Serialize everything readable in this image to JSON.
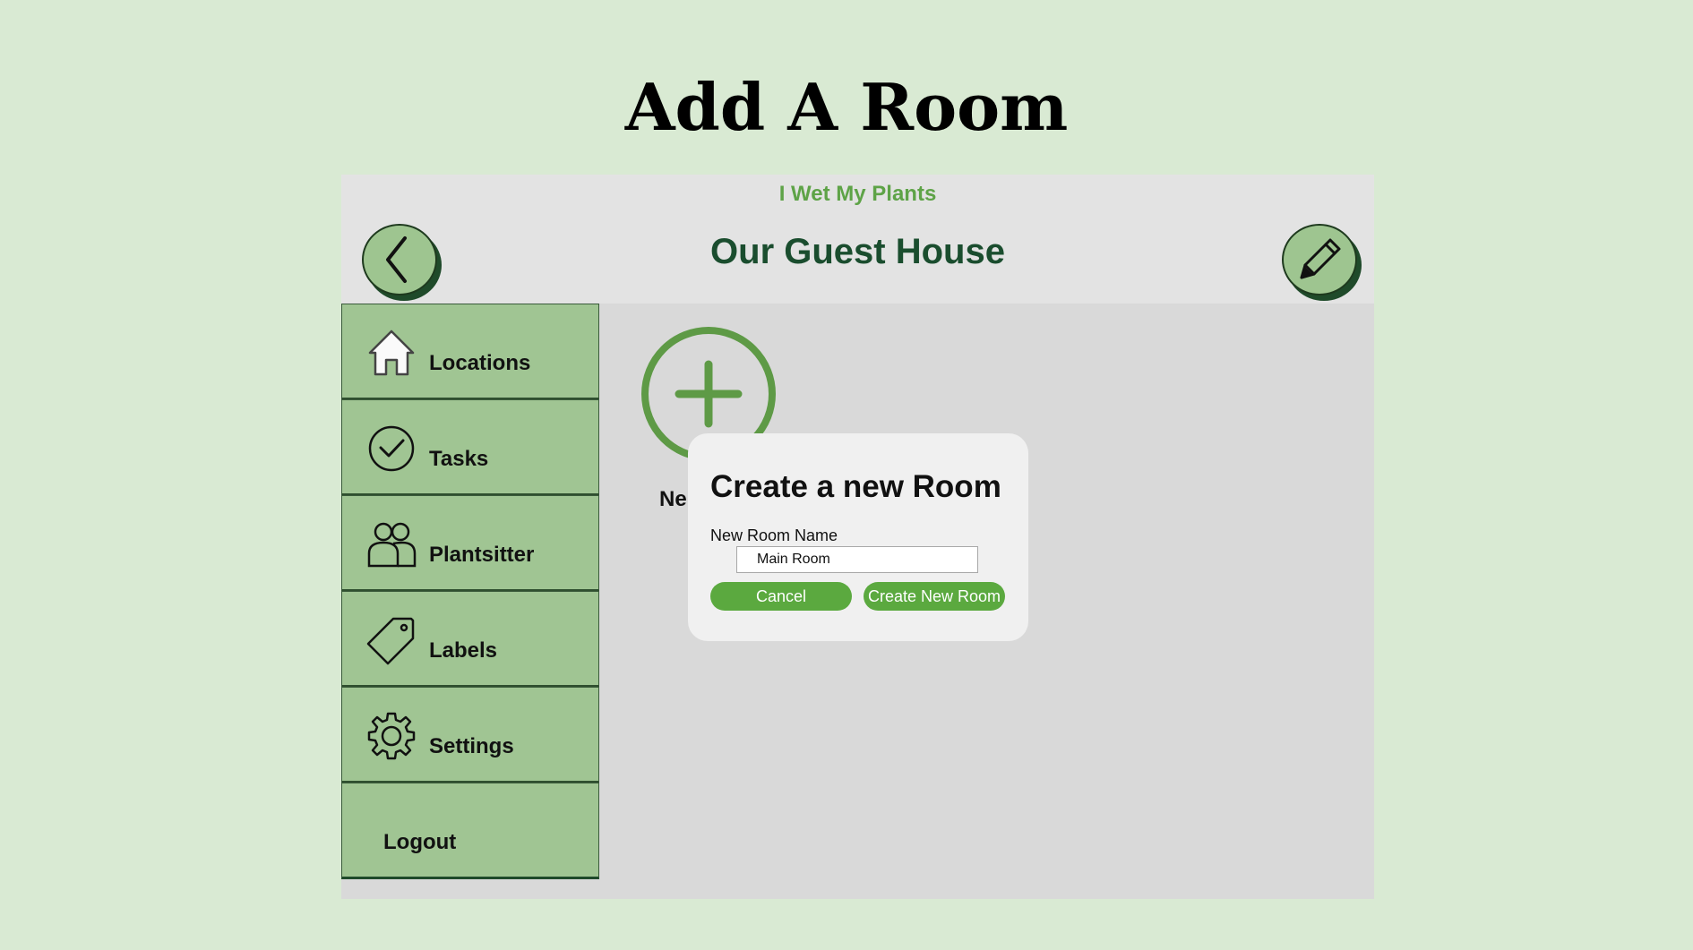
{
  "slide": {
    "title": "Add A Room",
    "background": "#d9ead3"
  },
  "app": {
    "brand": "I Wet My Plants",
    "heading": "Our Guest House",
    "back_icon": "chevron-left-icon",
    "edit_icon": "pencil-icon"
  },
  "sidebar": {
    "items": [
      {
        "label": "Locations",
        "icon": "home-icon"
      },
      {
        "label": "Tasks",
        "icon": "check-circle-icon"
      },
      {
        "label": "Plantsitter",
        "icon": "users-icon"
      },
      {
        "label": "Labels",
        "icon": "tag-icon"
      },
      {
        "label": "Settings",
        "icon": "gear-icon"
      },
      {
        "label": "Logout",
        "icon": ""
      }
    ]
  },
  "main": {
    "add_label": "Ne"
  },
  "modal": {
    "title": "Create a new Room",
    "field_label": "New Room Name",
    "field_value": "Main Room",
    "cancel_label": "Cancel",
    "create_label": "Create New Room"
  },
  "colors": {
    "accent": "#5ba93f",
    "sidebar": "#a0c593",
    "heading": "#1a4d2e",
    "brand": "#5ea347"
  }
}
